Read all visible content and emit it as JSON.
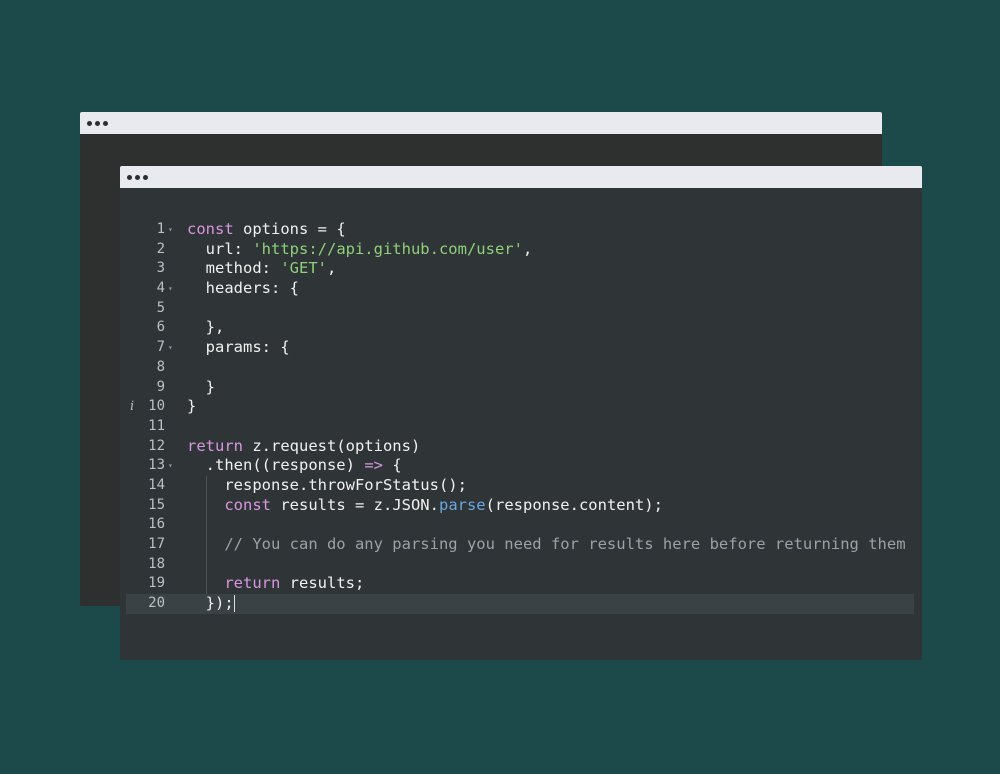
{
  "back_window": {
    "dots": 3
  },
  "front_window": {
    "dots": 3
  },
  "editor": {
    "info_marker": "i",
    "fold_glyph": "▾",
    "lines": [
      {
        "n": "1",
        "fold": true,
        "tokens": [
          {
            "t": "const",
            "c": "kw"
          },
          {
            "t": " options = {",
            "c": "op"
          }
        ]
      },
      {
        "n": "2",
        "tokens": [
          {
            "t": "  url: ",
            "c": "op"
          },
          {
            "t": "'https://api.github.com/user'",
            "c": "str"
          },
          {
            "t": ",",
            "c": "op"
          }
        ]
      },
      {
        "n": "3",
        "tokens": [
          {
            "t": "  method: ",
            "c": "op"
          },
          {
            "t": "'GET'",
            "c": "str"
          },
          {
            "t": ",",
            "c": "op"
          }
        ]
      },
      {
        "n": "4",
        "fold": true,
        "tokens": [
          {
            "t": "  headers: {",
            "c": "op"
          }
        ]
      },
      {
        "n": "5",
        "tokens": []
      },
      {
        "n": "6",
        "tokens": [
          {
            "t": "  },",
            "c": "op"
          }
        ]
      },
      {
        "n": "7",
        "fold": true,
        "tokens": [
          {
            "t": "  params: {",
            "c": "op"
          }
        ]
      },
      {
        "n": "8",
        "tokens": []
      },
      {
        "n": "9",
        "tokens": [
          {
            "t": "  }",
            "c": "op"
          }
        ]
      },
      {
        "n": "10",
        "info": true,
        "tokens": [
          {
            "t": "}",
            "c": "op"
          }
        ]
      },
      {
        "n": "11",
        "tokens": []
      },
      {
        "n": "12",
        "tokens": [
          {
            "t": "return",
            "c": "kw"
          },
          {
            "t": " z.request(options)",
            "c": "op"
          }
        ]
      },
      {
        "n": "13",
        "fold": true,
        "tokens": [
          {
            "t": "  .then((response) ",
            "c": "op"
          },
          {
            "t": "=>",
            "c": "kw"
          },
          {
            "t": " {",
            "c": "op"
          }
        ]
      },
      {
        "n": "14",
        "tokens": [
          {
            "t": "    response.throwForStatus();",
            "c": "op"
          }
        ]
      },
      {
        "n": "15",
        "tokens": [
          {
            "t": "    ",
            "c": "op"
          },
          {
            "t": "const",
            "c": "kw"
          },
          {
            "t": " results = z.JSON.",
            "c": "op"
          },
          {
            "t": "parse",
            "c": "fn"
          },
          {
            "t": "(response.content);",
            "c": "op"
          }
        ]
      },
      {
        "n": "16",
        "tokens": []
      },
      {
        "n": "17",
        "tokens": [
          {
            "t": "    // You can do any parsing you need for results here before returning them",
            "c": "cm"
          }
        ]
      },
      {
        "n": "18",
        "tokens": []
      },
      {
        "n": "19",
        "tokens": [
          {
            "t": "    ",
            "c": "op"
          },
          {
            "t": "return",
            "c": "kw"
          },
          {
            "t": " results;",
            "c": "op"
          }
        ]
      },
      {
        "n": "20",
        "active": true,
        "cursor": true,
        "tokens": [
          {
            "t": "  });",
            "c": "op"
          }
        ]
      }
    ]
  }
}
